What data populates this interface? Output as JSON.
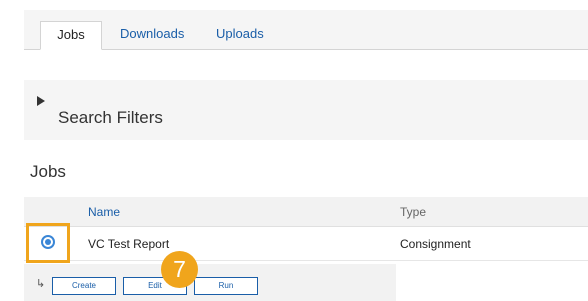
{
  "tabs": [
    {
      "label": "Jobs",
      "active": true
    },
    {
      "label": "Downloads",
      "active": false
    },
    {
      "label": "Uploads",
      "active": false
    }
  ],
  "filters": {
    "title": "Search Filters"
  },
  "jobs": {
    "title": "Jobs",
    "columns": [
      "Name",
      "Type"
    ],
    "rows": [
      {
        "name": "VC Test Report",
        "type": "Consignment",
        "selected": true
      }
    ]
  },
  "toolbar": {
    "buttons": [
      "Create",
      "Edit",
      "Run"
    ]
  },
  "annotation": {
    "step": "7",
    "color": "#f0a51c"
  }
}
